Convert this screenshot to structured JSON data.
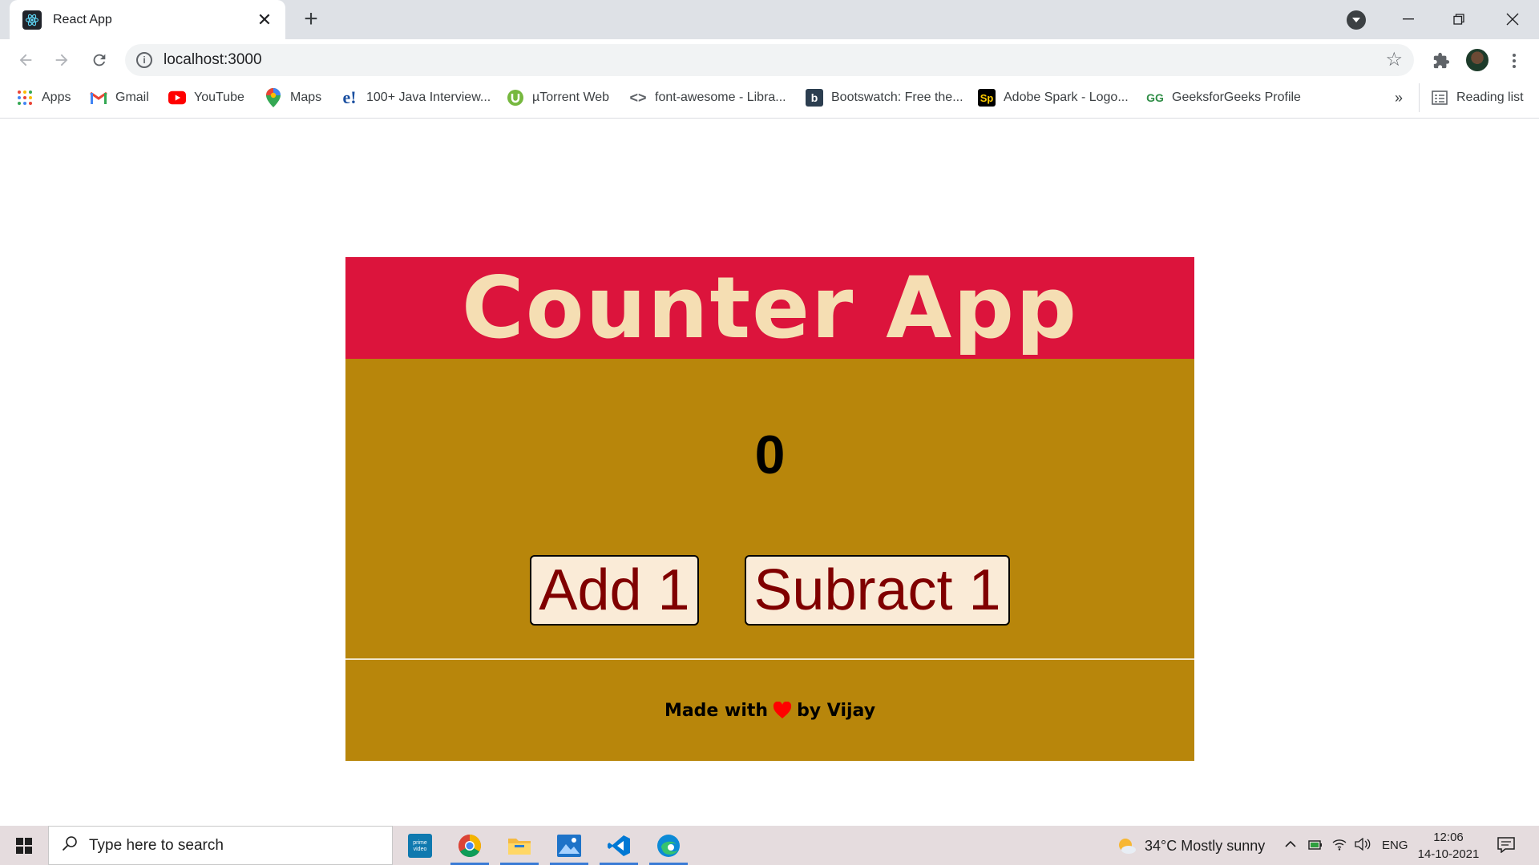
{
  "browser": {
    "tab_title": "React App",
    "url": "localhost:3000",
    "bookmarks": [
      {
        "label": "Apps",
        "icon": "apps-grid-icon"
      },
      {
        "label": "Gmail",
        "icon": "gmail-icon"
      },
      {
        "label": "YouTube",
        "icon": "youtube-icon"
      },
      {
        "label": "Maps",
        "icon": "maps-icon"
      },
      {
        "label": "100+ Java Interview...",
        "icon": "e-icon"
      },
      {
        "label": "µTorrent Web",
        "icon": "utorrent-icon"
      },
      {
        "label": "font-awesome - Libra...",
        "icon": "code-icon"
      },
      {
        "label": "Bootswatch: Free the...",
        "icon": "bootswatch-icon"
      },
      {
        "label": "Adobe Spark - Logo...",
        "icon": "adobe-spark-icon"
      },
      {
        "label": "GeeksforGeeks Profile",
        "icon": "geeksforgeeks-icon"
      }
    ],
    "overflow_label": "»",
    "reading_list_label": "Reading list"
  },
  "app": {
    "title": "Counter App",
    "count": "0",
    "add_label": "Add 1",
    "subtract_label": "Subract 1",
    "footer_prefix": "Made with",
    "footer_suffix": "by Vijay",
    "colors": {
      "header_bg": "#dc143c",
      "title_color": "#f5deb3",
      "body_bg": "#b8860b",
      "button_bg": "#faebd7",
      "button_text": "#800000",
      "heart": "#ff0000"
    }
  },
  "taskbar": {
    "search_placeholder": "Type here to search",
    "apps": [
      "prime-video-icon",
      "chrome-icon",
      "file-explorer-icon",
      "photos-icon",
      "vscode-icon",
      "edge-icon"
    ],
    "weather": "34°C  Mostly sunny",
    "language": "ENG",
    "time": "12:06",
    "date": "14-10-2021"
  }
}
